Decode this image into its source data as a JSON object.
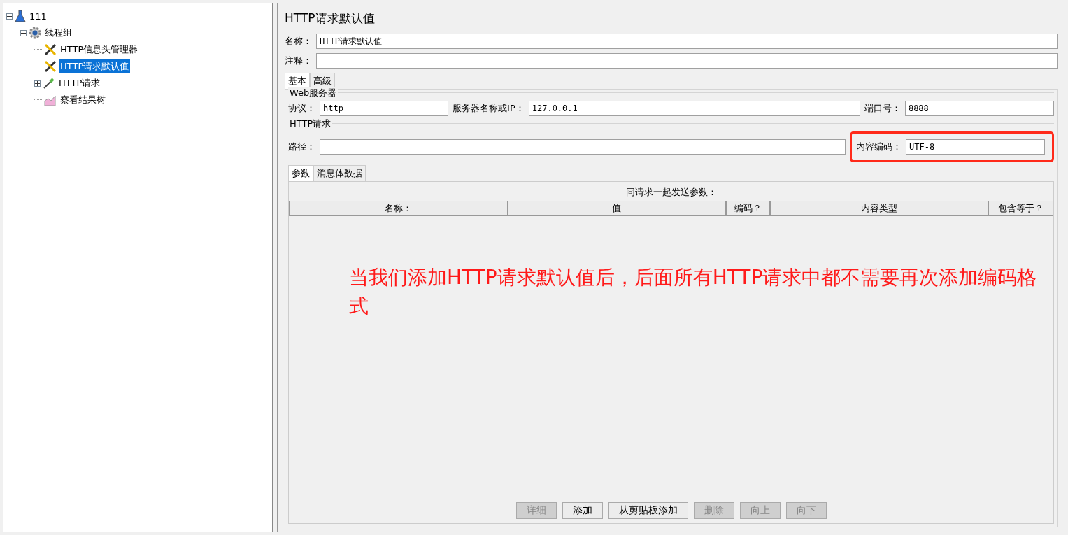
{
  "tree": [
    {
      "label": "111",
      "kind": "plan",
      "expanded": true,
      "selected": false,
      "children": [
        {
          "label": "线程组",
          "kind": "threads",
          "expanded": true,
          "selected": false,
          "children": [
            {
              "label": "HTTP信息头管理器",
              "kind": "config",
              "selected": false
            },
            {
              "label": "HTTP请求默认值",
              "kind": "config",
              "selected": true
            },
            {
              "label": "HTTP请求",
              "kind": "sampler",
              "expanded": false,
              "selected": false
            },
            {
              "label": "察看结果树",
              "kind": "listener",
              "selected": false
            }
          ]
        }
      ]
    }
  ],
  "panel": {
    "title": "HTTP请求默认值",
    "name_label": "名称：",
    "name_value": "HTTP请求默认值",
    "comment_label": "注释：",
    "tabs": [
      {
        "label": "基本",
        "selected": true
      },
      {
        "label": "高级",
        "selected": false
      }
    ],
    "web_server": {
      "legend": "Web服务器",
      "protocol_label": "协议：",
      "protocol_value": "http",
      "server_label": "服务器名称或IP：",
      "server_value": "127.0.0.1",
      "port_label": "端口号：",
      "port_value": "8888"
    },
    "http_request": {
      "legend": "HTTP请求",
      "path_label": "路径：",
      "encoding_label": "内容编码：",
      "encoding_value": "UTF-8",
      "encoding_highlighted": true
    },
    "sub_tabs": [
      {
        "label": "参数",
        "selected": true
      },
      {
        "label": "消息体数据",
        "selected": false
      }
    ],
    "table": {
      "caption": "同请求一起发送参数：",
      "columns": [
        "名称：",
        "值",
        "编码？",
        "内容类型",
        "包含等于？"
      ]
    },
    "annotation": "当我们添加HTTP请求默认值后，后面所有HTTP请求中都不需要再次添加编码格式",
    "buttons": [
      {
        "label": "详细",
        "disabled": true
      },
      {
        "label": "添加",
        "disabled": false
      },
      {
        "label": "从剪贴板添加",
        "disabled": false
      },
      {
        "label": "删除",
        "disabled": true
      },
      {
        "label": "向上",
        "disabled": true
      },
      {
        "label": "向下",
        "disabled": true
      }
    ]
  }
}
